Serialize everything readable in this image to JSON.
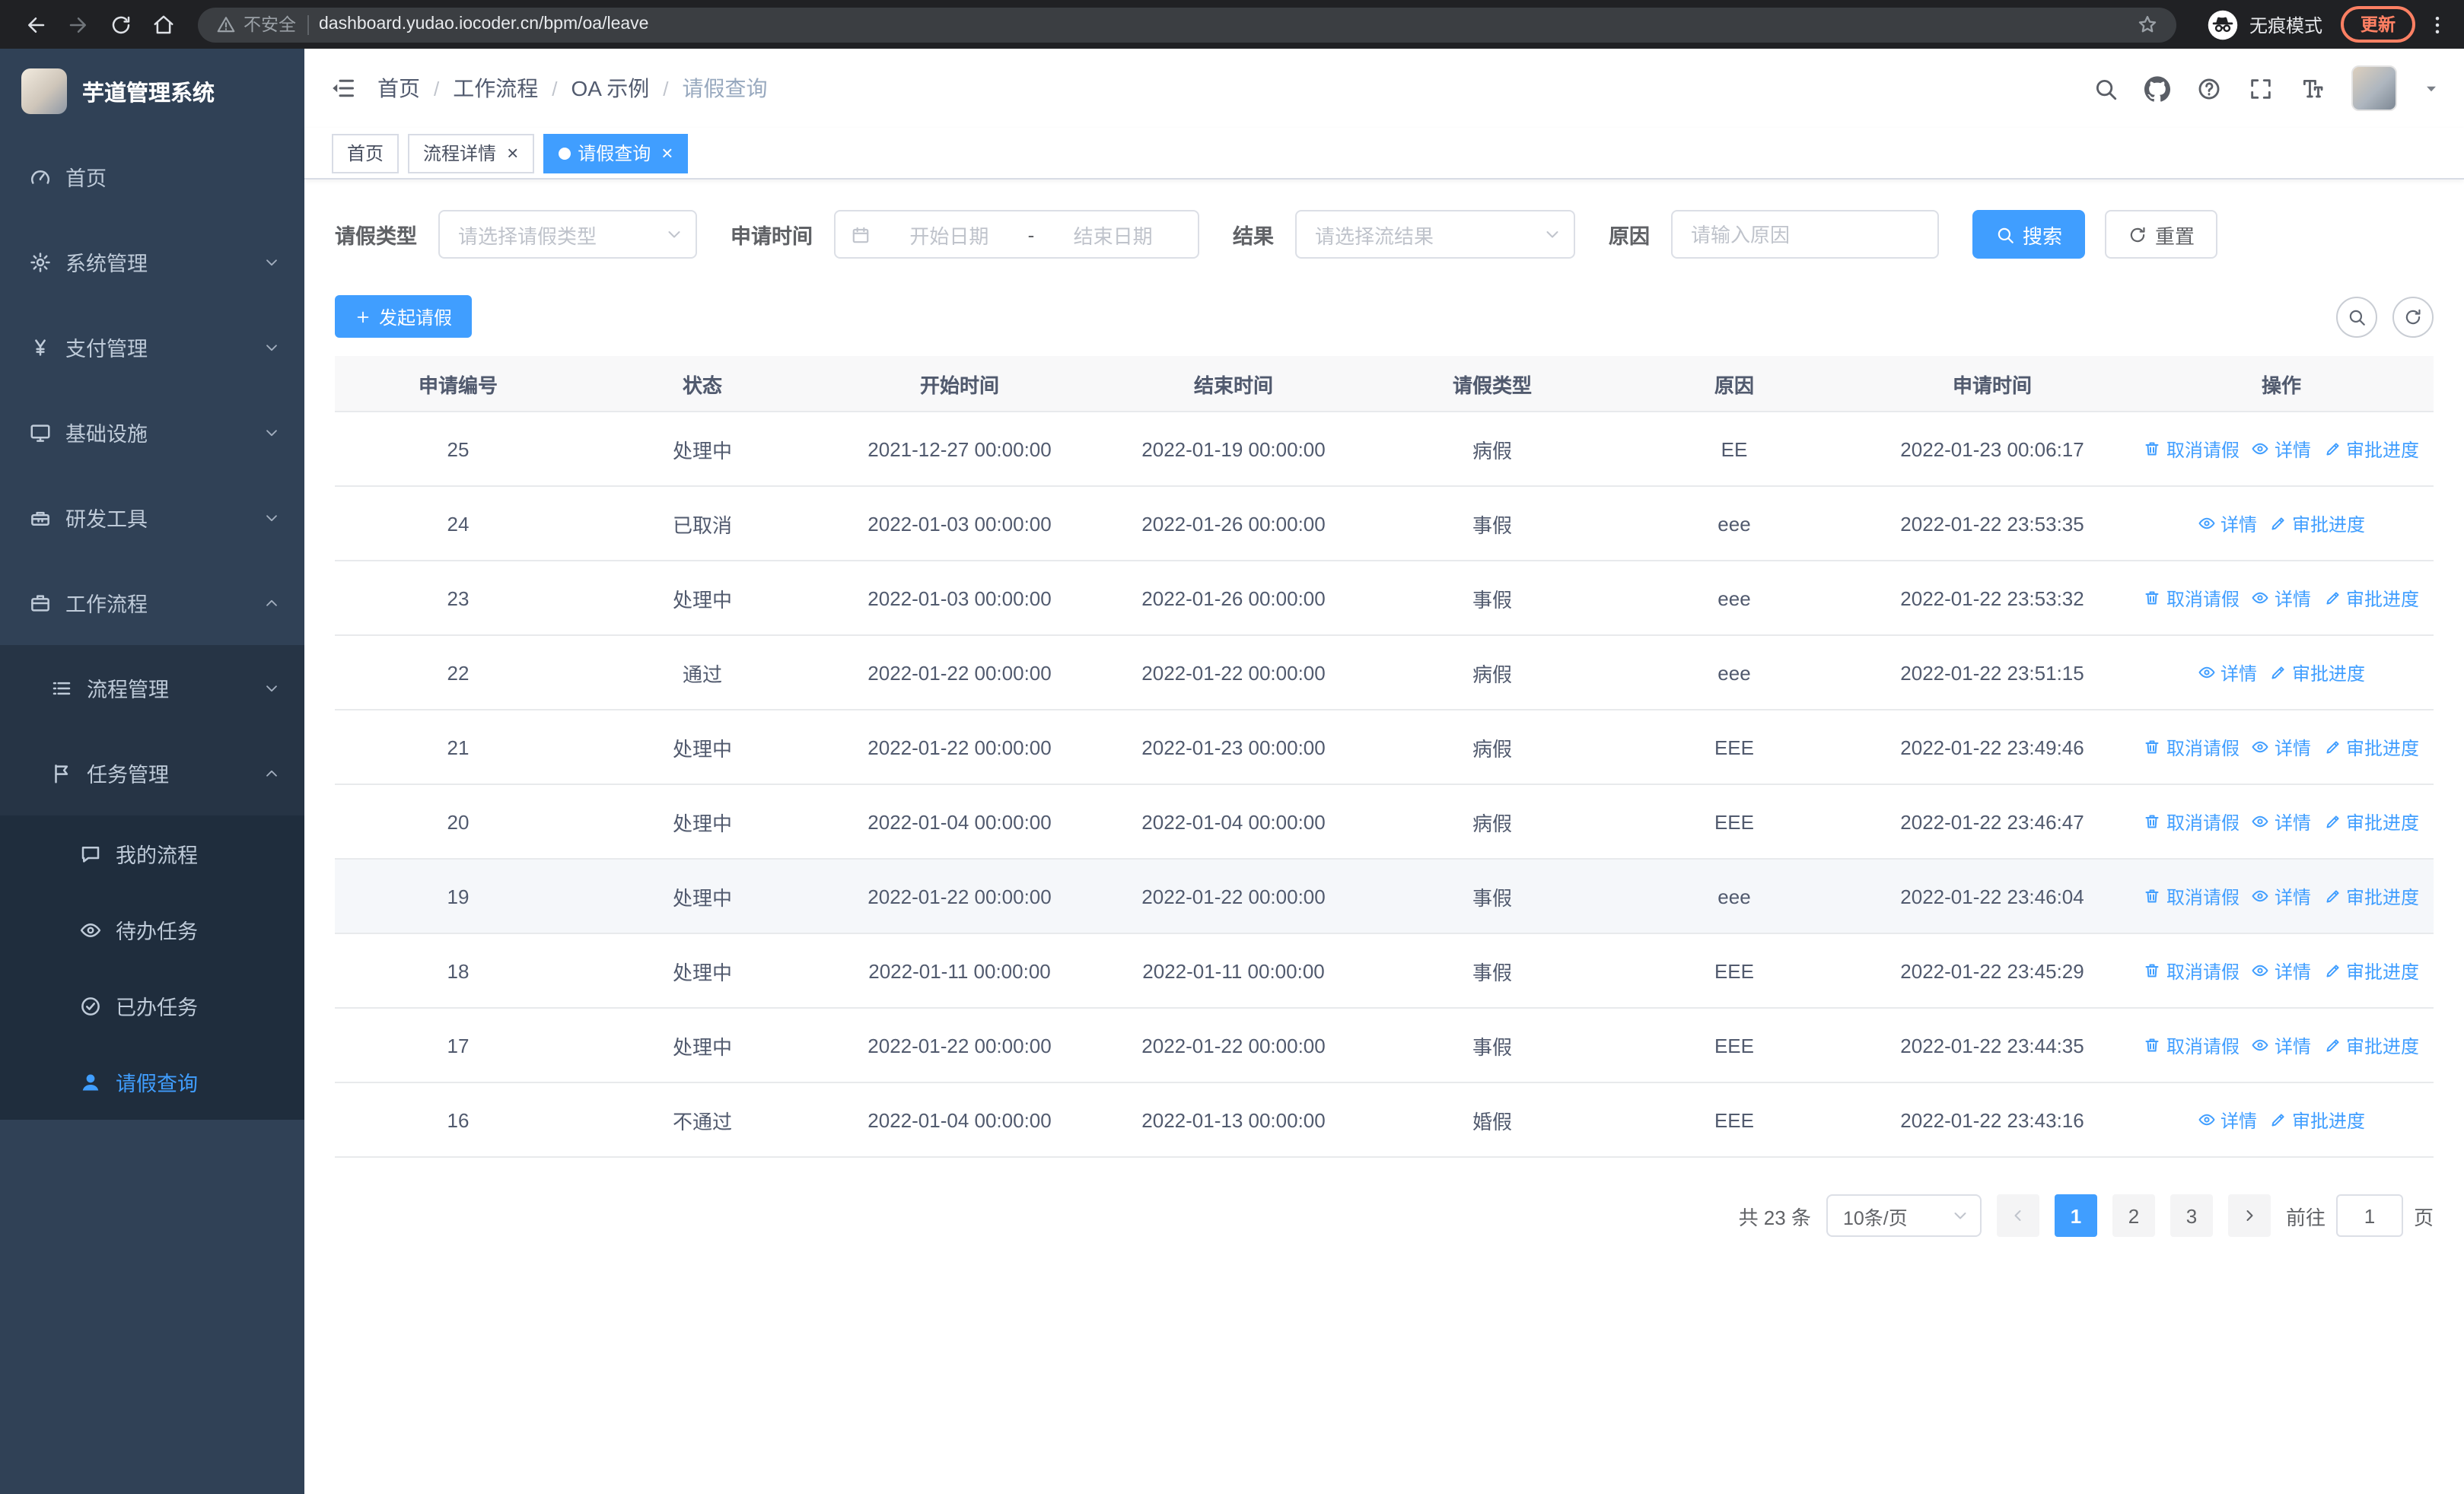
{
  "colors": {
    "accent": "#409eff",
    "sidebar_bg": "#304156",
    "submenu_bg": "#1f2d3d",
    "browser_chrome_bg": "#202124",
    "update_button": "#ff8063"
  },
  "browser": {
    "security_chip": "不安全",
    "url": "dashboard.yudao.iocoder.cn/bpm/oa/leave",
    "incognito_label": "无痕模式",
    "update_button": "更新"
  },
  "sidebar": {
    "logo_title": "芋道管理系统",
    "items": [
      {
        "label": "首页",
        "icon": "dashboard-icon",
        "level": 1
      },
      {
        "label": "系统管理",
        "icon": "gear-icon",
        "level": 1,
        "chevron": "down"
      },
      {
        "label": "支付管理",
        "icon": "yen-icon",
        "level": 1,
        "chevron": "down"
      },
      {
        "label": "基础设施",
        "icon": "monitor-icon",
        "level": 1,
        "chevron": "down"
      },
      {
        "label": "研发工具",
        "icon": "toolbox-icon",
        "level": 1,
        "chevron": "down"
      },
      {
        "label": "工作流程",
        "icon": "briefcase-icon",
        "level": 1,
        "chevron": "up"
      },
      {
        "label": "流程管理",
        "icon": "list-icon",
        "level": 2,
        "chevron": "down"
      },
      {
        "label": "任务管理",
        "icon": "flag-icon",
        "level": 2,
        "chevron": "up"
      },
      {
        "label": "我的流程",
        "icon": "chat-icon",
        "level": 3
      },
      {
        "label": "待办任务",
        "icon": "eye-icon",
        "level": 3
      },
      {
        "label": "已办任务",
        "icon": "check-circle-icon",
        "level": 3
      },
      {
        "label": "请假查询",
        "icon": "user-icon",
        "level": 3,
        "active": true
      }
    ]
  },
  "header": {
    "breadcrumb": [
      {
        "label": "首页"
      },
      {
        "label": "工作流程"
      },
      {
        "label": "OA 示例"
      },
      {
        "label": "请假查询",
        "current": true
      }
    ],
    "icons": [
      "search-icon",
      "github-icon",
      "question-icon",
      "fullscreen-icon",
      "fontsize-icon"
    ]
  },
  "tabs": [
    {
      "label": "首页",
      "closable": false,
      "active": false
    },
    {
      "label": "流程详情",
      "closable": true,
      "active": false
    },
    {
      "label": "请假查询",
      "closable": true,
      "active": true
    }
  ],
  "filters": {
    "leave_type_label": "请假类型",
    "leave_type_placeholder": "请选择请假类型",
    "apply_time_label": "申请时间",
    "start_date_placeholder": "开始日期",
    "range_separator": "-",
    "end_date_placeholder": "结束日期",
    "result_label": "结果",
    "result_placeholder": "请选择流结果",
    "reason_label": "原因",
    "reason_placeholder": "请输入原因",
    "search_button": "搜索",
    "reset_button": "重置"
  },
  "toolbar": {
    "create_button": "发起请假"
  },
  "table": {
    "columns": [
      "申请编号",
      "状态",
      "开始时间",
      "结束时间",
      "请假类型",
      "原因",
      "申请时间",
      "操作"
    ],
    "op_labels": {
      "cancel": "取消请假",
      "detail": "详情",
      "progress": "审批进度"
    },
    "op_icons": {
      "cancel": "trash-icon",
      "detail": "op-eye-icon",
      "progress": "edit-icon"
    },
    "rows": [
      {
        "id": "25",
        "status": "处理中",
        "start": "2021-12-27 00:00:00",
        "end": "2022-01-19 00:00:00",
        "type": "病假",
        "reason": "EE",
        "applied": "2022-01-23 00:06:17",
        "ops": [
          "cancel",
          "detail",
          "progress"
        ],
        "highlight": false
      },
      {
        "id": "24",
        "status": "已取消",
        "start": "2022-01-03 00:00:00",
        "end": "2022-01-26 00:00:00",
        "type": "事假",
        "reason": "eee",
        "applied": "2022-01-22 23:53:35",
        "ops": [
          "detail",
          "progress"
        ],
        "highlight": false
      },
      {
        "id": "23",
        "status": "处理中",
        "start": "2022-01-03 00:00:00",
        "end": "2022-01-26 00:00:00",
        "type": "事假",
        "reason": "eee",
        "applied": "2022-01-22 23:53:32",
        "ops": [
          "cancel",
          "detail",
          "progress"
        ],
        "highlight": false
      },
      {
        "id": "22",
        "status": "通过",
        "start": "2022-01-22 00:00:00",
        "end": "2022-01-22 00:00:00",
        "type": "病假",
        "reason": "eee",
        "applied": "2022-01-22 23:51:15",
        "ops": [
          "detail",
          "progress"
        ],
        "highlight": false
      },
      {
        "id": "21",
        "status": "处理中",
        "start": "2022-01-22 00:00:00",
        "end": "2022-01-23 00:00:00",
        "type": "病假",
        "reason": "EEE",
        "applied": "2022-01-22 23:49:46",
        "ops": [
          "cancel",
          "detail",
          "progress"
        ],
        "highlight": false
      },
      {
        "id": "20",
        "status": "处理中",
        "start": "2022-01-04 00:00:00",
        "end": "2022-01-04 00:00:00",
        "type": "病假",
        "reason": "EEE",
        "applied": "2022-01-22 23:46:47",
        "ops": [
          "cancel",
          "detail",
          "progress"
        ],
        "highlight": false
      },
      {
        "id": "19",
        "status": "处理中",
        "start": "2022-01-22 00:00:00",
        "end": "2022-01-22 00:00:00",
        "type": "事假",
        "reason": "eee",
        "applied": "2022-01-22 23:46:04",
        "ops": [
          "cancel",
          "detail",
          "progress"
        ],
        "highlight": true
      },
      {
        "id": "18",
        "status": "处理中",
        "start": "2022-01-11 00:00:00",
        "end": "2022-01-11 00:00:00",
        "type": "事假",
        "reason": "EEE",
        "applied": "2022-01-22 23:45:29",
        "ops": [
          "cancel",
          "detail",
          "progress"
        ],
        "highlight": false
      },
      {
        "id": "17",
        "status": "处理中",
        "start": "2022-01-22 00:00:00",
        "end": "2022-01-22 00:00:00",
        "type": "事假",
        "reason": "EEE",
        "applied": "2022-01-22 23:44:35",
        "ops": [
          "cancel",
          "detail",
          "progress"
        ],
        "highlight": false
      },
      {
        "id": "16",
        "status": "不通过",
        "start": "2022-01-04 00:00:00",
        "end": "2022-01-13 00:00:00",
        "type": "婚假",
        "reason": "EEE",
        "applied": "2022-01-22 23:43:16",
        "ops": [
          "detail",
          "progress"
        ],
        "highlight": false
      }
    ]
  },
  "pagination": {
    "total": "共 23 条",
    "page_size": "10条/页",
    "pages": [
      "1",
      "2",
      "3"
    ],
    "active_page": "1",
    "goto_label": "前往",
    "goto_value": "1",
    "goto_suffix": "页"
  }
}
